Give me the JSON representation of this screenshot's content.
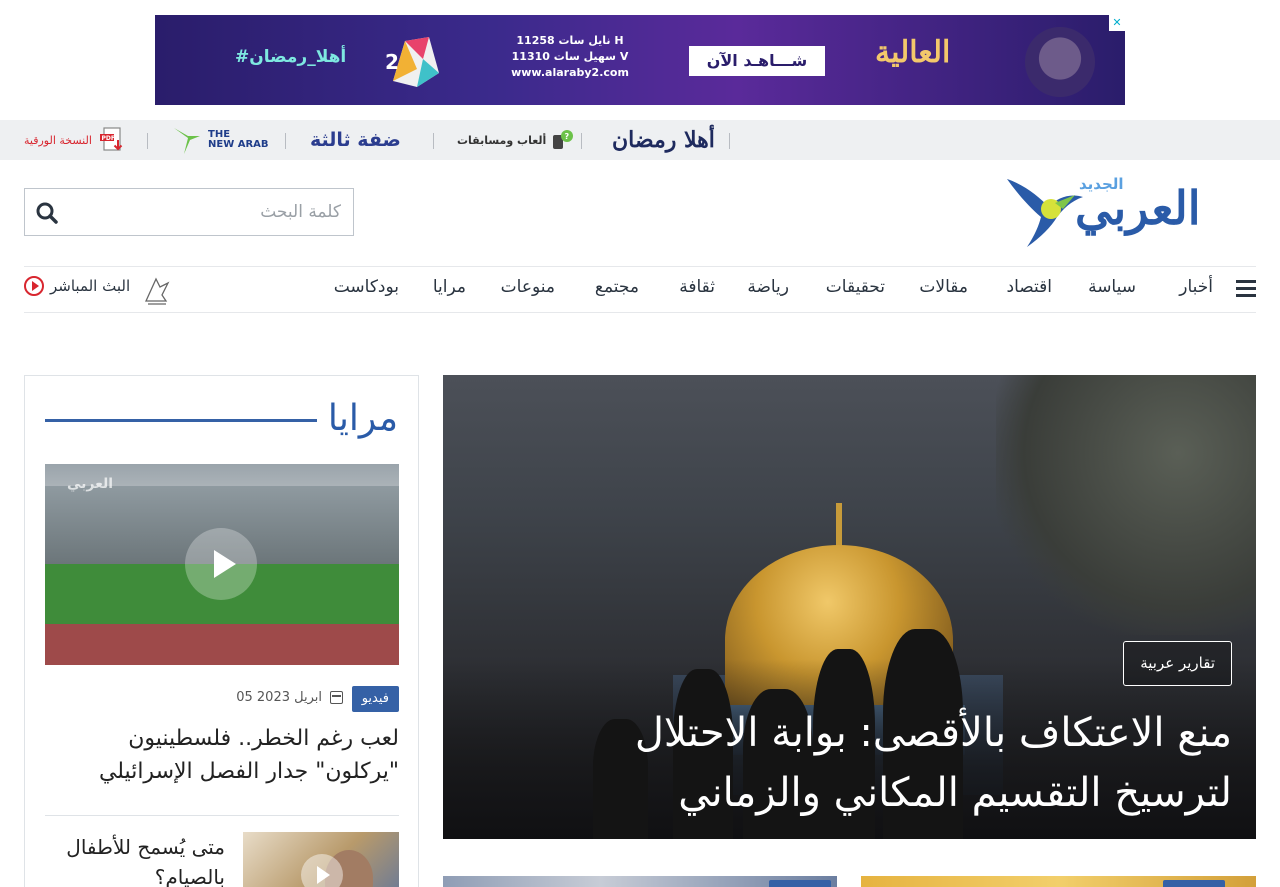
{
  "ad": {
    "hashtag": "#أهلا_رمضان",
    "freq_line1": "نايل سات 11258 H",
    "freq_line2": "سهيل سات 11310 V",
    "freq_line3": "www.alaraby2.com",
    "watch_label": "شـــاهـد الآن",
    "brand": "العالية"
  },
  "strip": {
    "paper_label": "النسخة الورقية",
    "newarab_line1": "THE",
    "newarab_line2": "NEW ARAB",
    "dahfa": "ضفة ثالثة",
    "games_label": "ألعاب ومسابقات",
    "ramadan": "أهلا رمضان"
  },
  "header": {
    "logo_main": "العربي",
    "logo_sub": "الجديد",
    "search_placeholder": "كلمة البحث"
  },
  "nav": {
    "items": [
      "أخبار",
      "سياسة",
      "اقتصاد",
      "مقالات",
      "تحقيقات",
      "رياضة",
      "ثقافة",
      "مجتمع",
      "منوعات",
      "مرايا",
      "بودكاست"
    ],
    "live_label": "البث المباشر"
  },
  "side": {
    "title": "مرايا",
    "video_watermark": "العربي",
    "badge": "فيديو",
    "date": "05 ابريل 2023",
    "headline": "لعب رغم الخطر.. فلسطينيون \"يركلون\" جدار الفصل الإسرائيلي",
    "second_headline": "متى يُسمح للأطفال بالصيام؟"
  },
  "hero": {
    "tag": "تقارير عربية",
    "title": "منع الاعتكاف بالأقصى: بوابة الاحتلال لترسيخ التقسيم المكاني والزماني"
  },
  "colors": {
    "brand_blue": "#3561a6",
    "live_red": "#d8262f",
    "strip_bg": "#eef0f2"
  }
}
